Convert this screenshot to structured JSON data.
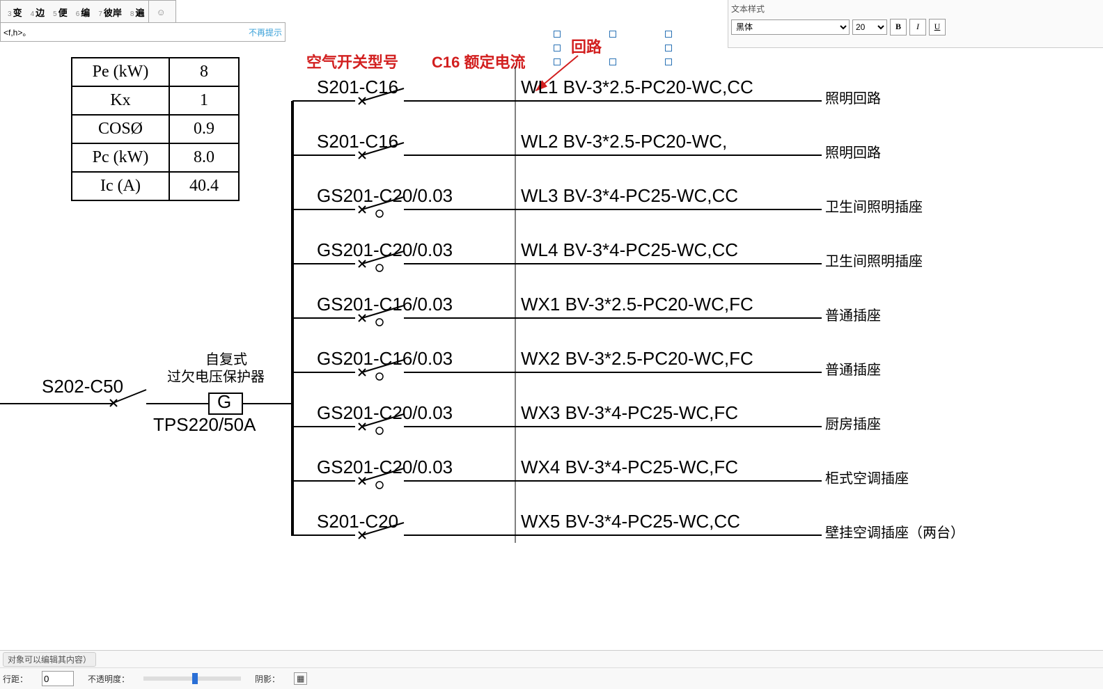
{
  "ime": {
    "candidates": [
      {
        "num": "3",
        "char": "变"
      },
      {
        "num": "4",
        "char": "边"
      },
      {
        "num": "5",
        "char": "便"
      },
      {
        "num": "6",
        "char": "编"
      },
      {
        "num": "7",
        "char": "彼岸"
      },
      {
        "num": "8",
        "char": "遍"
      }
    ],
    "hint_left": "<f,h>。",
    "hint_right": "不再提示"
  },
  "text_panel": {
    "title": "文本样式",
    "font": "黑体",
    "size": "20"
  },
  "status": {
    "top_text": "对象可以编辑其内容）",
    "line_spacing_label": "行距：",
    "line_spacing_value": "0",
    "opacity_label": "不透明度：",
    "shadow_label": "阴影："
  },
  "param_table": [
    {
      "label": "Pe (kW)",
      "value": "8"
    },
    {
      "label": "Kx",
      "value": "1"
    },
    {
      "label": "COSØ",
      "value": "0.9"
    },
    {
      "label": "Pc (kW)",
      "value": "8.0"
    },
    {
      "label": "Ic (A)",
      "value": "40.4"
    }
  ],
  "annotations": {
    "breaker_model": "空气开关型号",
    "rated_current": "C16  额定电流",
    "circuit_label": "回路"
  },
  "main_breaker": {
    "model": "S202-C50",
    "protector_line1": "自复式",
    "protector_line2": "过欠电压保护器",
    "protector_symbol": "G",
    "protector_model": "TPS220/50A"
  },
  "circuits": [
    {
      "breaker": "S201-C16",
      "id": "WL1",
      "cable": "BV-3*2.5-PC20-WC,CC",
      "desc": "照明回路",
      "rcd": false
    },
    {
      "breaker": "S201-C16",
      "id": "WL2",
      "cable": "BV-3*2.5-PC20-WC,",
      "desc": "照明回路",
      "rcd": false
    },
    {
      "breaker": "GS201-C20/0.03",
      "id": "WL3",
      "cable": "BV-3*4-PC25-WC,CC",
      "desc": "卫生间照明插座",
      "rcd": true
    },
    {
      "breaker": "GS201-C20/0.03",
      "id": "WL4",
      "cable": "BV-3*4-PC25-WC,CC",
      "desc": "卫生间照明插座",
      "rcd": true
    },
    {
      "breaker": "GS201-C16/0.03",
      "id": "WX1",
      "cable": "BV-3*2.5-PC20-WC,FC",
      "desc": "普通插座",
      "rcd": true
    },
    {
      "breaker": "GS201-C16/0.03",
      "id": "WX2",
      "cable": "BV-3*2.5-PC20-WC,FC",
      "desc": "普通插座",
      "rcd": true
    },
    {
      "breaker": "GS201-C20/0.03",
      "id": "WX3",
      "cable": "BV-3*4-PC25-WC,FC",
      "desc": "厨房插座",
      "rcd": true
    },
    {
      "breaker": "GS201-C20/0.03",
      "id": "WX4",
      "cable": "BV-3*4-PC25-WC,FC",
      "desc": "柜式空调插座",
      "rcd": true
    },
    {
      "breaker": "S201-C20",
      "id": "WX5",
      "cable": "BV-3*4-PC25-WC,CC",
      "desc": "壁挂空调插座（两台）",
      "rcd": false
    }
  ]
}
